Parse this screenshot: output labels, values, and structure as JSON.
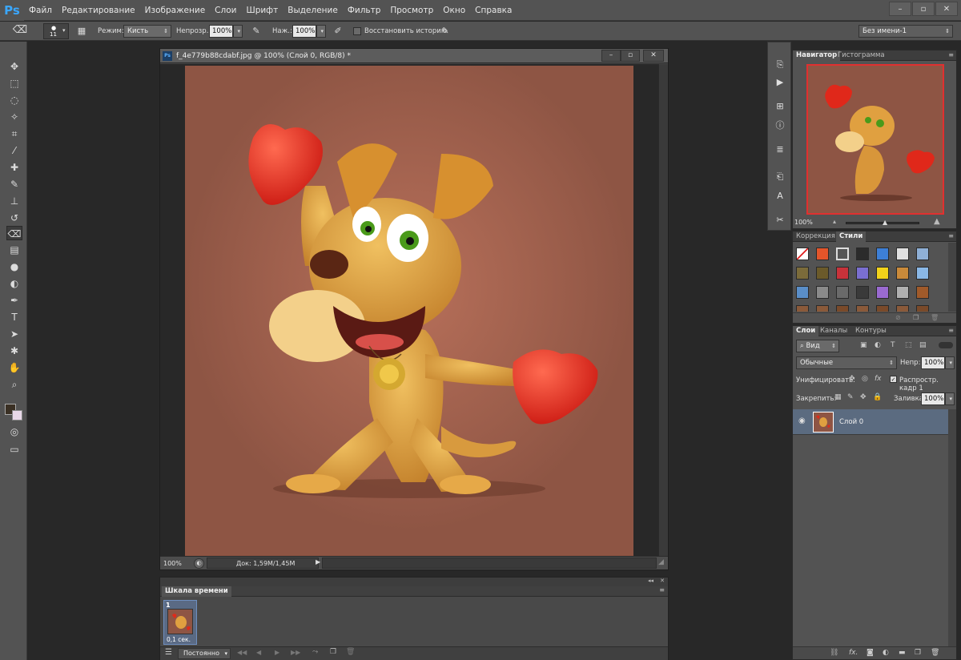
{
  "app": {
    "logo": "Ps"
  },
  "menu": [
    "Файл",
    "Редактирование",
    "Изображение",
    "Слои",
    "Шрифт",
    "Выделение",
    "Фильтр",
    "Просмотр",
    "Окно",
    "Справка"
  ],
  "window_controls": {
    "minimize": "–",
    "restore": "▫",
    "close": "✕"
  },
  "options": {
    "brush_size": "11",
    "mode_label": "Режим:",
    "mode_value": "Кисть",
    "opacity_label": "Непрозр.:",
    "opacity_value": "100%",
    "flow_label": "Наж.:",
    "flow_value": "100%",
    "restore_history_label": "Восстановить историю",
    "workspace": "Без имени-1"
  },
  "document": {
    "title": "f_4e779b88cdabf.jpg @ 100% (Слой 0, RGB/8) *",
    "icon": "Ps",
    "zoom": "100%",
    "doc_info": "Док: 1,59M/1,45M",
    "canvas_color": "#8e5544"
  },
  "timeline": {
    "title": "Шкала времени",
    "frame_number": "1",
    "frame_delay": "0,1 сек.",
    "loop": "Постоянно"
  },
  "navigator": {
    "tabs": [
      "Навигатор",
      "Гистограмма"
    ],
    "zoom": "100%"
  },
  "styles_panel": {
    "tabs": [
      "Коррекция",
      "Стили"
    ],
    "swatches": [
      "#ffffff",
      "#e3552a",
      "#d8d8d8",
      "#2b2b2b",
      "#3d7fd6",
      "#e0e0e0",
      "#8fb0d6",
      "#7b6b3a",
      "#6b5a2a",
      "#c8323a",
      "#7a6fd0",
      "#f2d21a",
      "#c98a3a",
      "#8ab8e6",
      "#5a8ec8",
      "#8a8a8a",
      "#6a6a6a",
      "#3a3a3a",
      "#9a6ad0",
      "#b0b0b0",
      "#a05a2a",
      "#8a5a3a",
      "#8a5a3a",
      "#7a4a2a",
      "#8a5a3a",
      "#7a4a2a",
      "#8a5a3a",
      "#7a4a2a"
    ]
  },
  "layers_panel": {
    "tabs": [
      "Слои",
      "Каналы",
      "Контуры"
    ],
    "filter": "Вид",
    "blend_mode": "Обычные",
    "opacity_label": "Непр:",
    "opacity_value": "100%",
    "unify_label": "Унифицировать:",
    "propagate_label": "Распростр. кадр 1",
    "lock_label": "Закрепить:",
    "fill_label": "Заливка:",
    "fill_value": "100%",
    "layers": [
      {
        "name": "Слой 0"
      }
    ]
  },
  "colors": {
    "foreground": "#3a3024",
    "background": "#e8d8e8",
    "accent": "#3aa7ff"
  }
}
